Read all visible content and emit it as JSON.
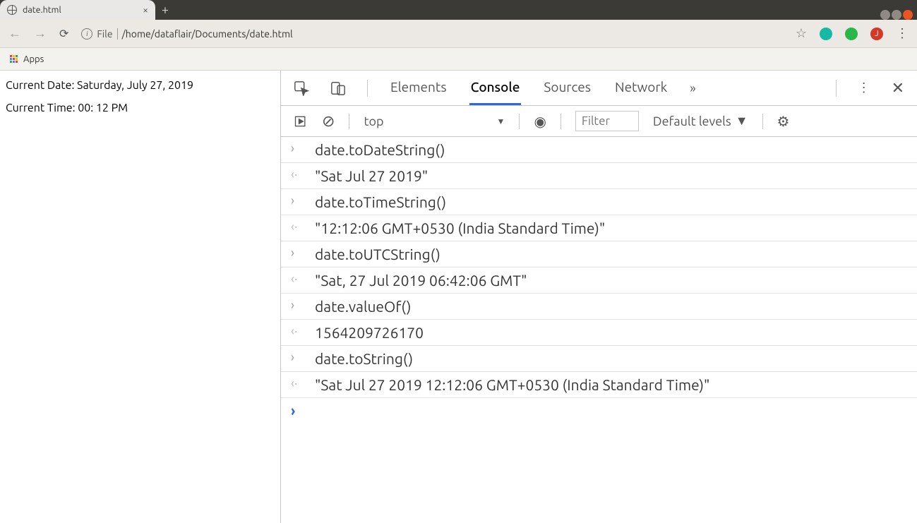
{
  "window": {
    "tab_title": "date.html",
    "new_tab_glyph": "+",
    "close_tab_glyph": "×"
  },
  "toolbar": {
    "scheme_label": "File",
    "url_path": "/home/dataflair/Documents/date.html",
    "apps_label": "Apps",
    "avatar_letter": "J"
  },
  "page": {
    "line1": "Current Date: Saturday, July 27, 2019",
    "line2": "Current Time: 00: 12 PM"
  },
  "devtools": {
    "tabs": {
      "elements": "Elements",
      "console": "Console",
      "sources": "Sources",
      "network": "Network"
    },
    "sub": {
      "context": "top",
      "filter_placeholder": "Filter",
      "levels": "Default levels"
    },
    "entries": [
      {
        "input": "date.toDateString()",
        "output": "\"Sat Jul 27 2019\"",
        "kind": "str"
      },
      {
        "input": "date.toTimeString()",
        "output": "\"12:12:06 GMT+0530 (India Standard Time)\"",
        "kind": "str"
      },
      {
        "input": "date.toUTCString()",
        "output": "\"Sat, 27 Jul 2019 06:42:06 GMT\"",
        "kind": "str"
      },
      {
        "input": "date.valueOf()",
        "output": "1564209726170",
        "kind": "num"
      },
      {
        "input": "date.toString()",
        "output": "\"Sat Jul 27 2019 12:12:06 GMT+0530 (India Standard Time)\"",
        "kind": "str"
      }
    ]
  }
}
